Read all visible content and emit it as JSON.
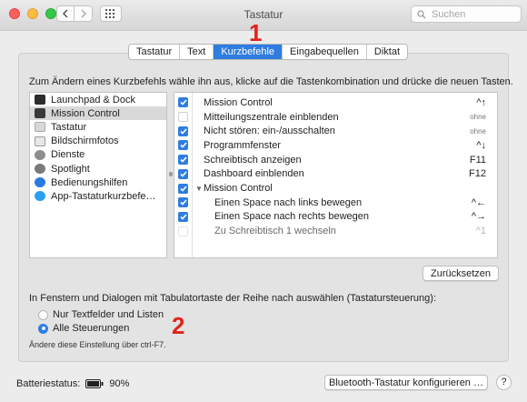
{
  "window": {
    "title": "Tastatur",
    "search_placeholder": "Suchen"
  },
  "tabs": [
    {
      "label": "Tastatur",
      "active": false
    },
    {
      "label": "Text",
      "active": false
    },
    {
      "label": "Kurzbefehle",
      "active": true
    },
    {
      "label": "Eingabequellen",
      "active": false
    },
    {
      "label": "Diktat",
      "active": false
    }
  ],
  "annotations": {
    "one": "1",
    "two": "2"
  },
  "instructions": "Zum Ändern eines Kurzbefehls wähle ihn aus, klicke auf die Tastenkombination und drücke die neuen Tasten.",
  "categories": [
    {
      "label": "Launchpad & Dock",
      "icon": "launchpad-icon",
      "selected": false
    },
    {
      "label": "Mission Control",
      "icon": "mission-control-icon",
      "selected": true
    },
    {
      "label": "Tastatur",
      "icon": "keyboard-icon",
      "selected": false
    },
    {
      "label": "Bildschirmfotos",
      "icon": "screenshot-icon",
      "selected": false
    },
    {
      "label": "Dienste",
      "icon": "gear-icon",
      "selected": false
    },
    {
      "label": "Spotlight",
      "icon": "spotlight-icon",
      "selected": false
    },
    {
      "label": "Bedienungshilfen",
      "icon": "accessibility-icon",
      "selected": false
    },
    {
      "label": "App-Tastaturkurzbefe…",
      "icon": "app-shortcuts-icon",
      "selected": false
    }
  ],
  "shortcuts": [
    {
      "label": "Mission Control",
      "key": "^↑",
      "checked": true,
      "indent": 0,
      "disclosure": false,
      "dim": false
    },
    {
      "label": "Mitteilungszentrale einblenden",
      "key": "ohne",
      "checked": false,
      "indent": 0,
      "disclosure": false,
      "dim": false
    },
    {
      "label": "Nicht stören: ein-/ausschalten",
      "key": "ohne",
      "checked": true,
      "indent": 0,
      "disclosure": false,
      "dim": false
    },
    {
      "label": "Programmfenster",
      "key": "^↓",
      "checked": true,
      "indent": 0,
      "disclosure": false,
      "dim": false
    },
    {
      "label": "Schreibtisch anzeigen",
      "key": "F11",
      "checked": true,
      "indent": 0,
      "disclosure": false,
      "dim": false
    },
    {
      "label": "Dashboard einblenden",
      "key": "F12",
      "checked": true,
      "indent": 0,
      "disclosure": false,
      "dim": false
    },
    {
      "label": "Mission Control",
      "key": "",
      "checked": true,
      "indent": 0,
      "disclosure": true,
      "dim": false
    },
    {
      "label": "Einen Space nach links bewegen",
      "key": "^←",
      "checked": true,
      "indent": 1,
      "disclosure": false,
      "dim": false
    },
    {
      "label": "Einen Space nach rechts bewegen",
      "key": "^→",
      "checked": true,
      "indent": 1,
      "disclosure": false,
      "dim": false
    },
    {
      "label": "Zu Schreibtisch 1 wechseln",
      "key": "^1",
      "checked": false,
      "indent": 1,
      "disclosure": false,
      "dim": true
    }
  ],
  "buttons": {
    "reset": "Zurücksetzen",
    "bluetooth": "Bluetooth-Tastatur konfigurieren …",
    "help": "?"
  },
  "tab_navigation": {
    "text": "In Fenstern und Dialogen mit Tabulatortaste der Reihe nach auswählen (Tastatursteuerung):",
    "options": [
      {
        "label": "Nur Textfelder und Listen",
        "selected": false
      },
      {
        "label": "Alle Steuerungen",
        "selected": true
      }
    ],
    "hint": "Ändere diese Einstellung über ctrl-F7."
  },
  "battery": {
    "label": "Batteriestatus:",
    "value": "90%"
  },
  "colors": {
    "accent": "#2f7de1",
    "annotation": "#e2231a"
  }
}
